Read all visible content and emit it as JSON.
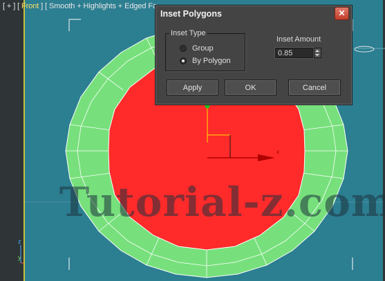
{
  "viewport": {
    "label_open": "[ + ] [ ",
    "view_name": "Front",
    "label_rest": " ] [ Smooth + Highlights + Edged Fa",
    "axis_z": "z",
    "axis_y": "y",
    "axis_x": "x",
    "watermark": "Tutorial-z.com",
    "colors": {
      "background": "#2c7e91",
      "inner_face": "#ff2a2a",
      "inset_ring": "#77e07c"
    }
  },
  "dialog": {
    "title": "Inset Polygons",
    "close_label": "✕",
    "inset_type": {
      "legend": "Inset Type",
      "options": [
        "Group",
        "By Polygon"
      ],
      "selected": "By Polygon"
    },
    "inset_amount": {
      "label": "Inset Amount",
      "value": "0.85"
    },
    "buttons": {
      "apply": "Apply",
      "ok": "OK",
      "cancel": "Cancel"
    }
  }
}
